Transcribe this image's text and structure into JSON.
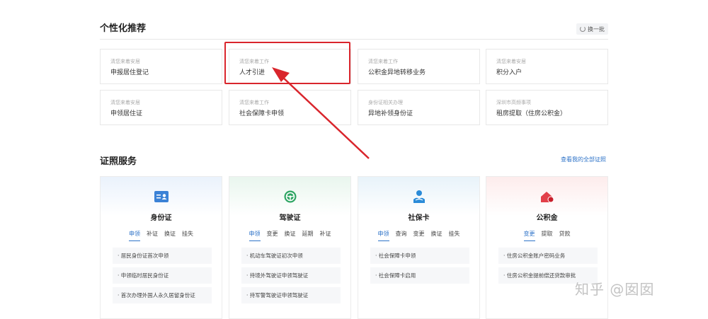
{
  "recommend": {
    "title": "个性化推荐",
    "refresh_label": "换一批",
    "cards": [
      {
        "tag": "清您来着安居",
        "name": "申报居住登记"
      },
      {
        "tag": "清您来着工作",
        "name": "人才引进"
      },
      {
        "tag": "清您来着工作",
        "name": "公积金异地转移业务"
      },
      {
        "tag": "清您来着安居",
        "name": "积分入户"
      },
      {
        "tag": "清您来着安居",
        "name": "申领居住证"
      },
      {
        "tag": "清您来着工作",
        "name": "社会保障卡申领"
      },
      {
        "tag": "身份证相关办理",
        "name": "异地补领身份证"
      },
      {
        "tag": "深圳市高频事项",
        "name": "租房提取（住房公积金）"
      }
    ]
  },
  "certificates": {
    "title": "证照服务",
    "view_all": "查看我的全部证照",
    "cards": [
      {
        "name": "身份证",
        "icon": "id-card-icon",
        "tabs": [
          "申领",
          "补证",
          "换证",
          "挂失"
        ],
        "items": [
          "居民身份证首次申领",
          "申领临时居民身份证",
          "首次办理外国人永久居留身份证"
        ]
      },
      {
        "name": "驾驶证",
        "icon": "steering-wheel-icon",
        "tabs": [
          "申领",
          "变更",
          "换证",
          "延期",
          "补证"
        ],
        "items": [
          "机动车驾驶证初次申领",
          "持境外驾驶证申领驾驶证",
          "持军警驾驶证申领驾驶证"
        ]
      },
      {
        "name": "社保卡",
        "icon": "social-security-icon",
        "tabs": [
          "申领",
          "查询",
          "变更",
          "换证",
          "挂失"
        ],
        "items": [
          "社会保障卡申领",
          "社会保障卡启用"
        ]
      },
      {
        "name": "公积金",
        "icon": "housing-fund-icon",
        "tabs": [
          "变更",
          "提取",
          "贷款"
        ],
        "items": [
          "住房公积金账户密码业务",
          "住房公积金提前偿还贷款审批"
        ]
      }
    ]
  },
  "watermark": "知乎 @囡囡",
  "colors": {
    "accent": "#2e73c8",
    "highlight": "#d9252c"
  }
}
